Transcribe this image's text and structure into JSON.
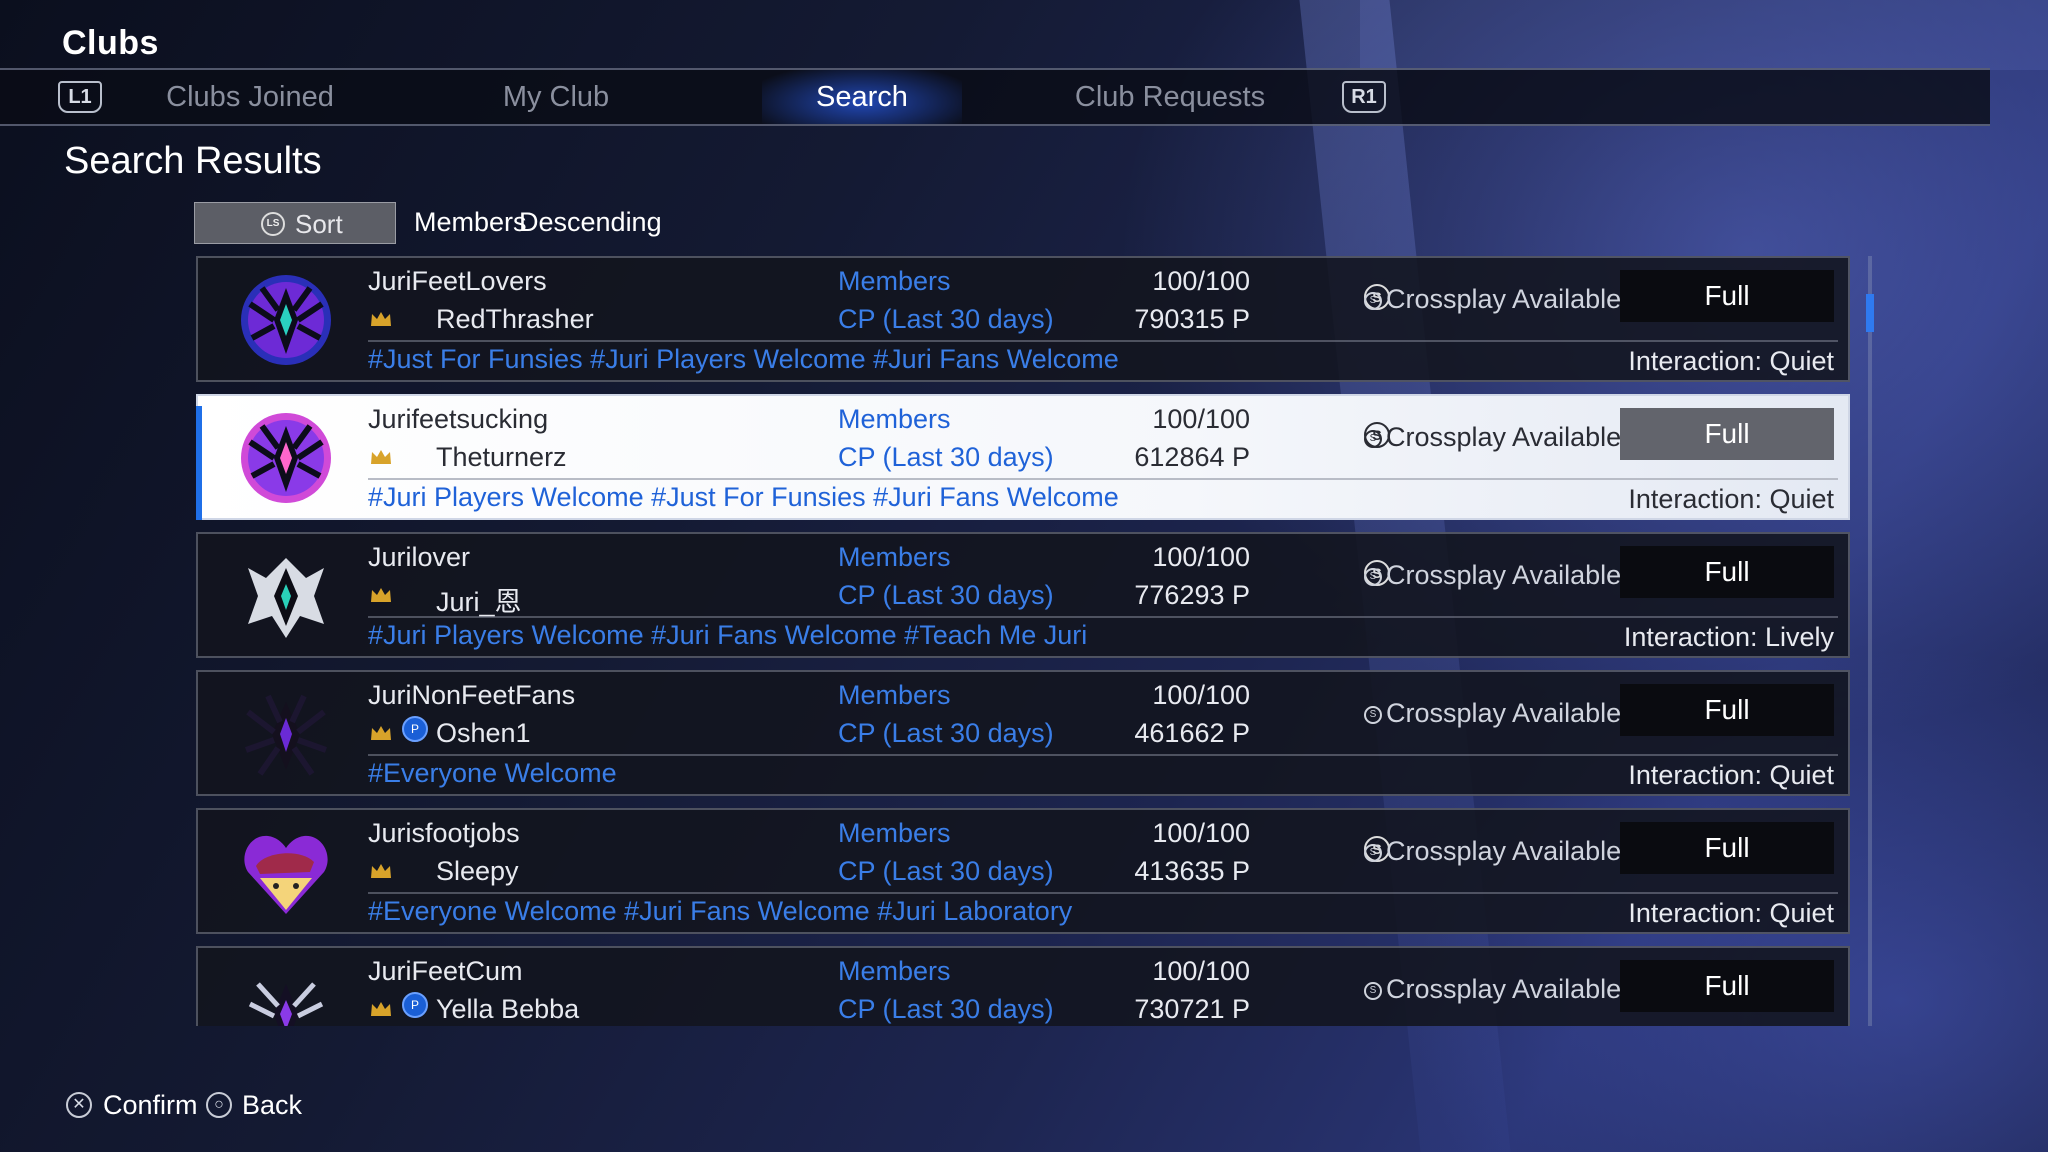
{
  "app": {
    "title": "Clubs"
  },
  "tabs": {
    "left_shoulder": "L1",
    "right_shoulder": "R1",
    "items": [
      {
        "label": "Clubs Joined"
      },
      {
        "label": "My Club"
      },
      {
        "label": "Search"
      },
      {
        "label": "Club Requests"
      }
    ],
    "active": "Search"
  },
  "section_title": "Search Results",
  "sort": {
    "button_icon": "LS",
    "button_label": "Sort",
    "field": "Members",
    "order": "Descending"
  },
  "labels": {
    "members": "Members",
    "cp": "CP (Last 30 days)",
    "crossplay": "Crossplay Available"
  },
  "colors": {
    "accent": "#1f6fe8",
    "tag_blue": "#3a7ee8"
  },
  "clubs": [
    {
      "name": "JuriFeetLovers",
      "leader": "RedThrasher",
      "platform": "crossplay-icon",
      "members": "100/100",
      "cp": "790315 P",
      "status": "Full",
      "tags": "#Just For Funsies #Juri Players Welcome #Juri Fans Welcome",
      "interaction": "Interaction: Quiet",
      "emblem": "spider-emblem-blue"
    },
    {
      "name": "Jurifeetsucking",
      "leader": "Theturnerz",
      "platform": "crossplay-icon",
      "members": "100/100",
      "cp": "612864 P",
      "status": "Full",
      "tags": "#Juri Players Welcome #Just For Funsies #Juri Fans Welcome",
      "interaction": "Interaction: Quiet",
      "emblem": "spider-emblem-pink"
    },
    {
      "name": "Jurilover",
      "leader": "Juri_恩",
      "platform": "crossplay-icon",
      "members": "100/100",
      "cp": "776293 P",
      "status": "Full",
      "tags": "#Juri Players Welcome #Juri Fans Welcome #Teach Me Juri",
      "interaction": "Interaction: Lively",
      "emblem": "spider-emblem-white"
    },
    {
      "name": "JuriNonFeetFans",
      "leader": "Oshen1",
      "platform": "playstation-icon",
      "members": "100/100",
      "cp": "461662 P",
      "status": "Full",
      "tags": "#Everyone Welcome",
      "interaction": "Interaction: Quiet",
      "emblem": "spider-emblem-dark"
    },
    {
      "name": "Jurisfootjobs",
      "leader": "Sleepy",
      "platform": "crossplay-icon",
      "members": "100/100",
      "cp": "413635 P",
      "status": "Full",
      "tags": "#Everyone Welcome #Juri Fans Welcome #Juri Laboratory",
      "interaction": "Interaction: Quiet",
      "emblem": "heart-face-emblem"
    },
    {
      "name": "JuriFeetCum",
      "leader": "Yella Bebba",
      "platform": "playstation-icon",
      "members": "100/100",
      "cp": "730721 P",
      "status": "Full",
      "tags": "",
      "interaction": "",
      "emblem": "spider-emblem-purple"
    }
  ],
  "footer": {
    "confirm": "Confirm",
    "back": "Back"
  }
}
